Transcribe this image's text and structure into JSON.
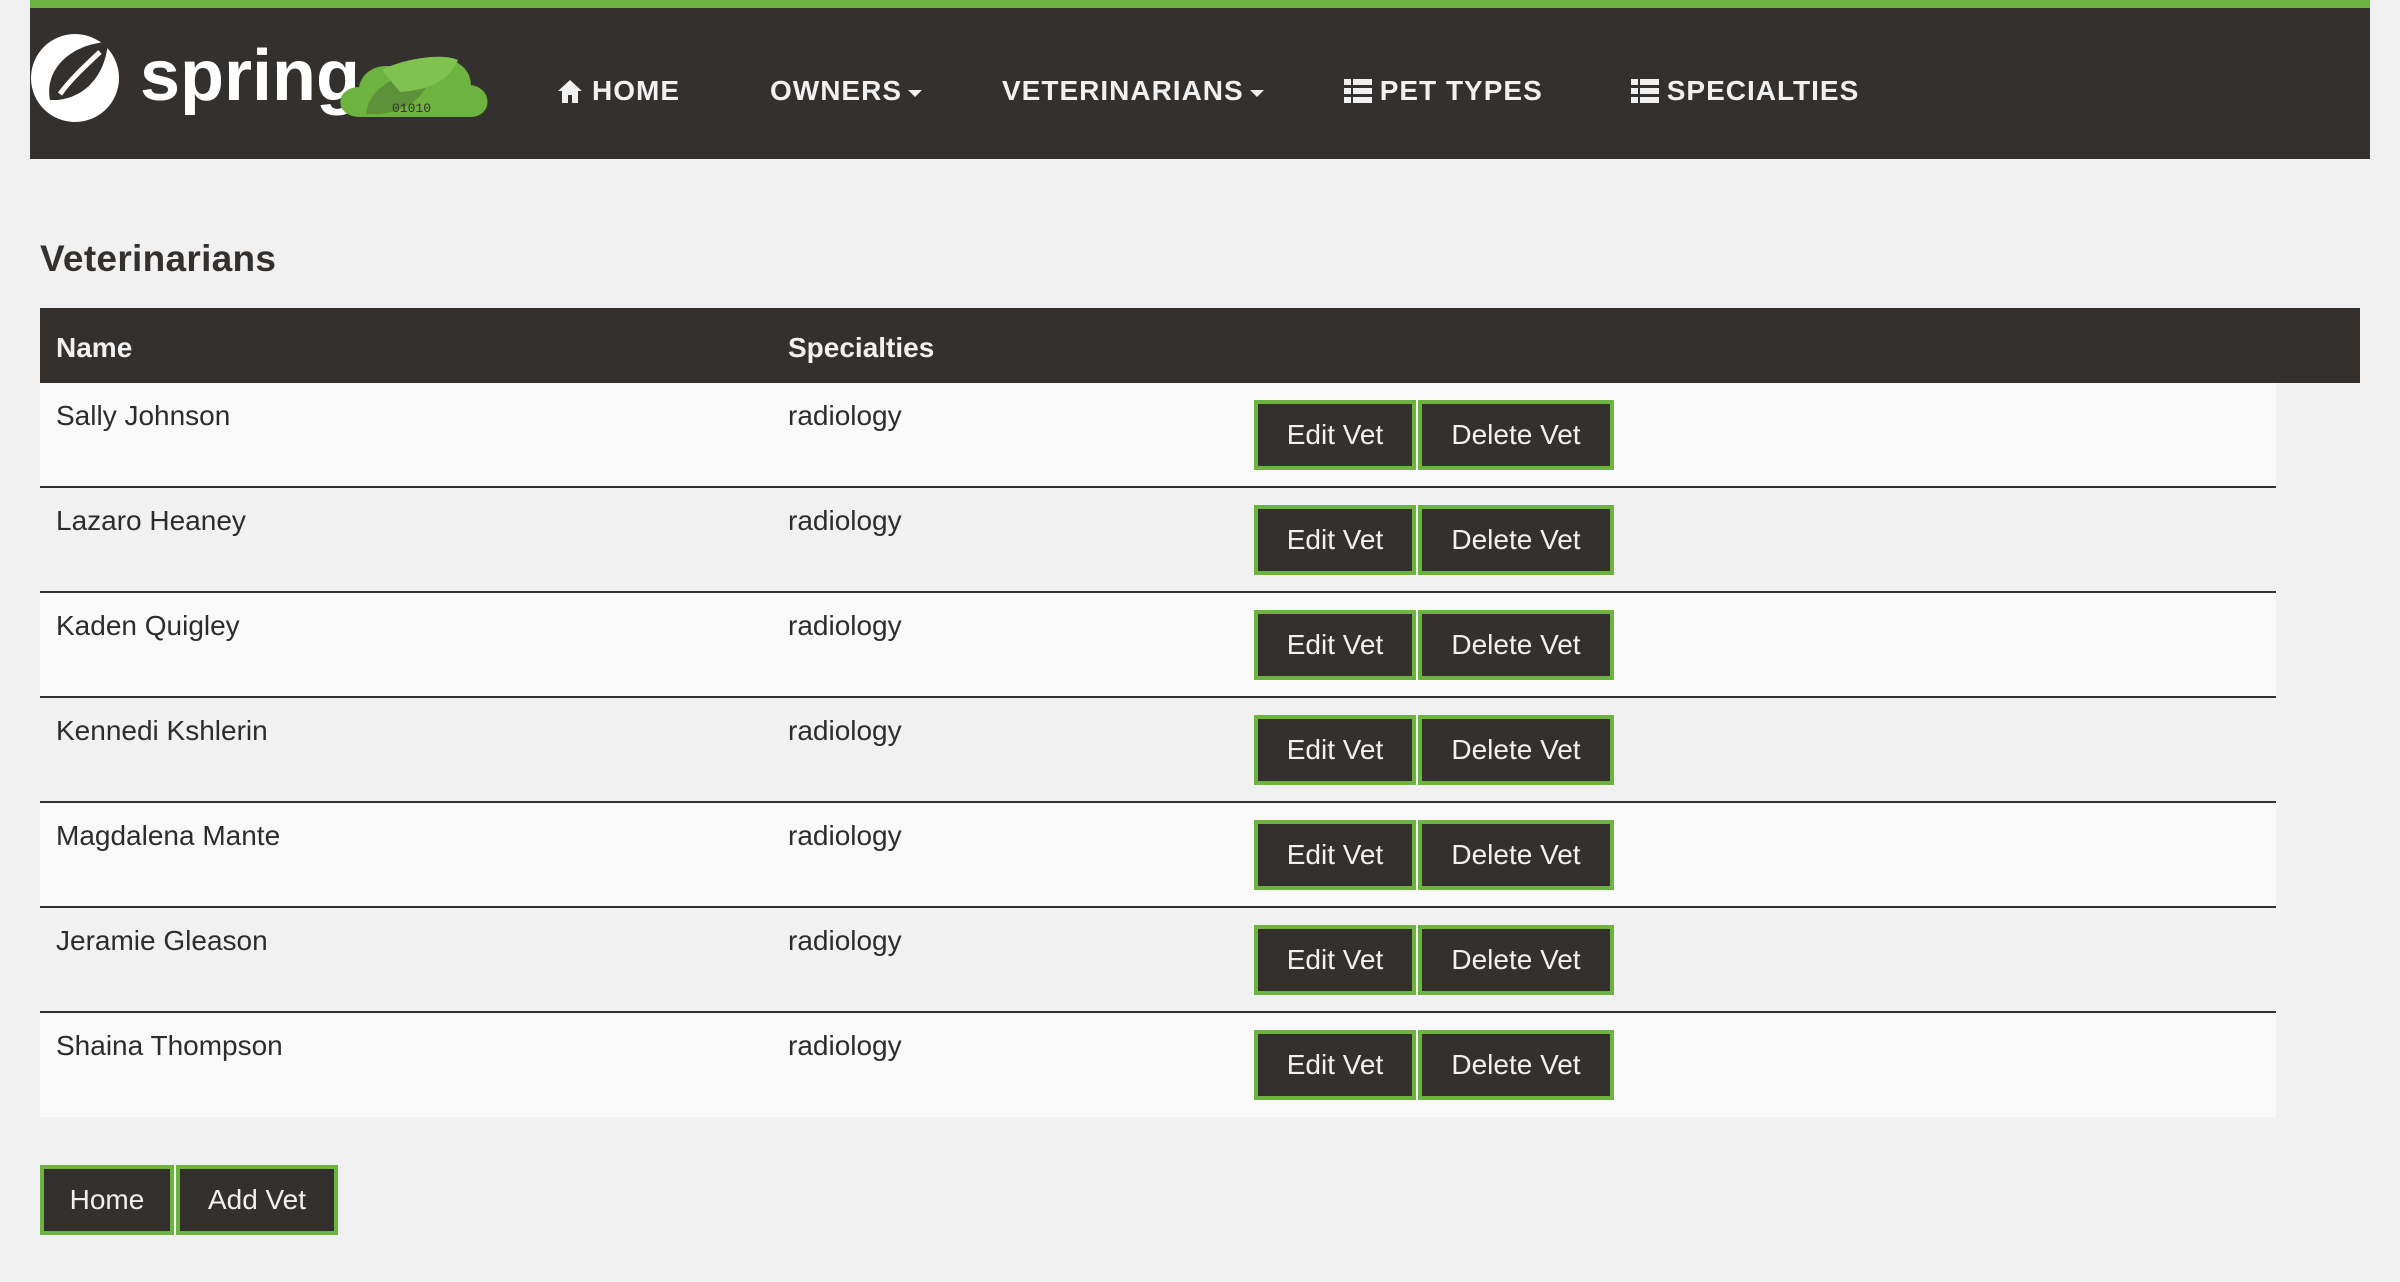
{
  "brand": {
    "logo_text": "spring",
    "logo_binary": "01010"
  },
  "nav": {
    "home": "Home",
    "owners": "Owners",
    "veterinarians": "Veterinarians",
    "pet_types": "Pet Types",
    "specialties": "Specialties"
  },
  "page": {
    "title": "Veterinarians"
  },
  "table": {
    "headers": {
      "name": "Name",
      "specialties": "Specialties"
    },
    "rows": [
      {
        "name": "Sally Johnson",
        "specialties": "radiology",
        "edit": "Edit Vet",
        "delete": "Delete Vet"
      },
      {
        "name": "Lazaro Heaney",
        "specialties": "radiology",
        "edit": "Edit Vet",
        "delete": "Delete Vet"
      },
      {
        "name": "Kaden Quigley",
        "specialties": "radiology",
        "edit": "Edit Vet",
        "delete": "Delete Vet"
      },
      {
        "name": "Kennedi Kshlerin",
        "specialties": "radiology",
        "edit": "Edit Vet",
        "delete": "Delete Vet"
      },
      {
        "name": "Magdalena Mante",
        "specialties": "radiology",
        "edit": "Edit Vet",
        "delete": "Delete Vet"
      },
      {
        "name": "Jeramie Gleason",
        "specialties": "radiology",
        "edit": "Edit Vet",
        "delete": "Delete Vet"
      },
      {
        "name": "Shaina Thompson",
        "specialties": "radiology",
        "edit": "Edit Vet",
        "delete": "Delete Vet"
      }
    ]
  },
  "footer": {
    "home_label": "Home",
    "add_vet_label": "Add Vet"
  },
  "icons": {
    "home": "home-icon",
    "list": "list-icon",
    "caret": "caret-down-icon",
    "logo": "spring-logo"
  },
  "colors": {
    "accent": "#6db33f",
    "dark": "#34302d",
    "background": "#f1f1f1"
  }
}
